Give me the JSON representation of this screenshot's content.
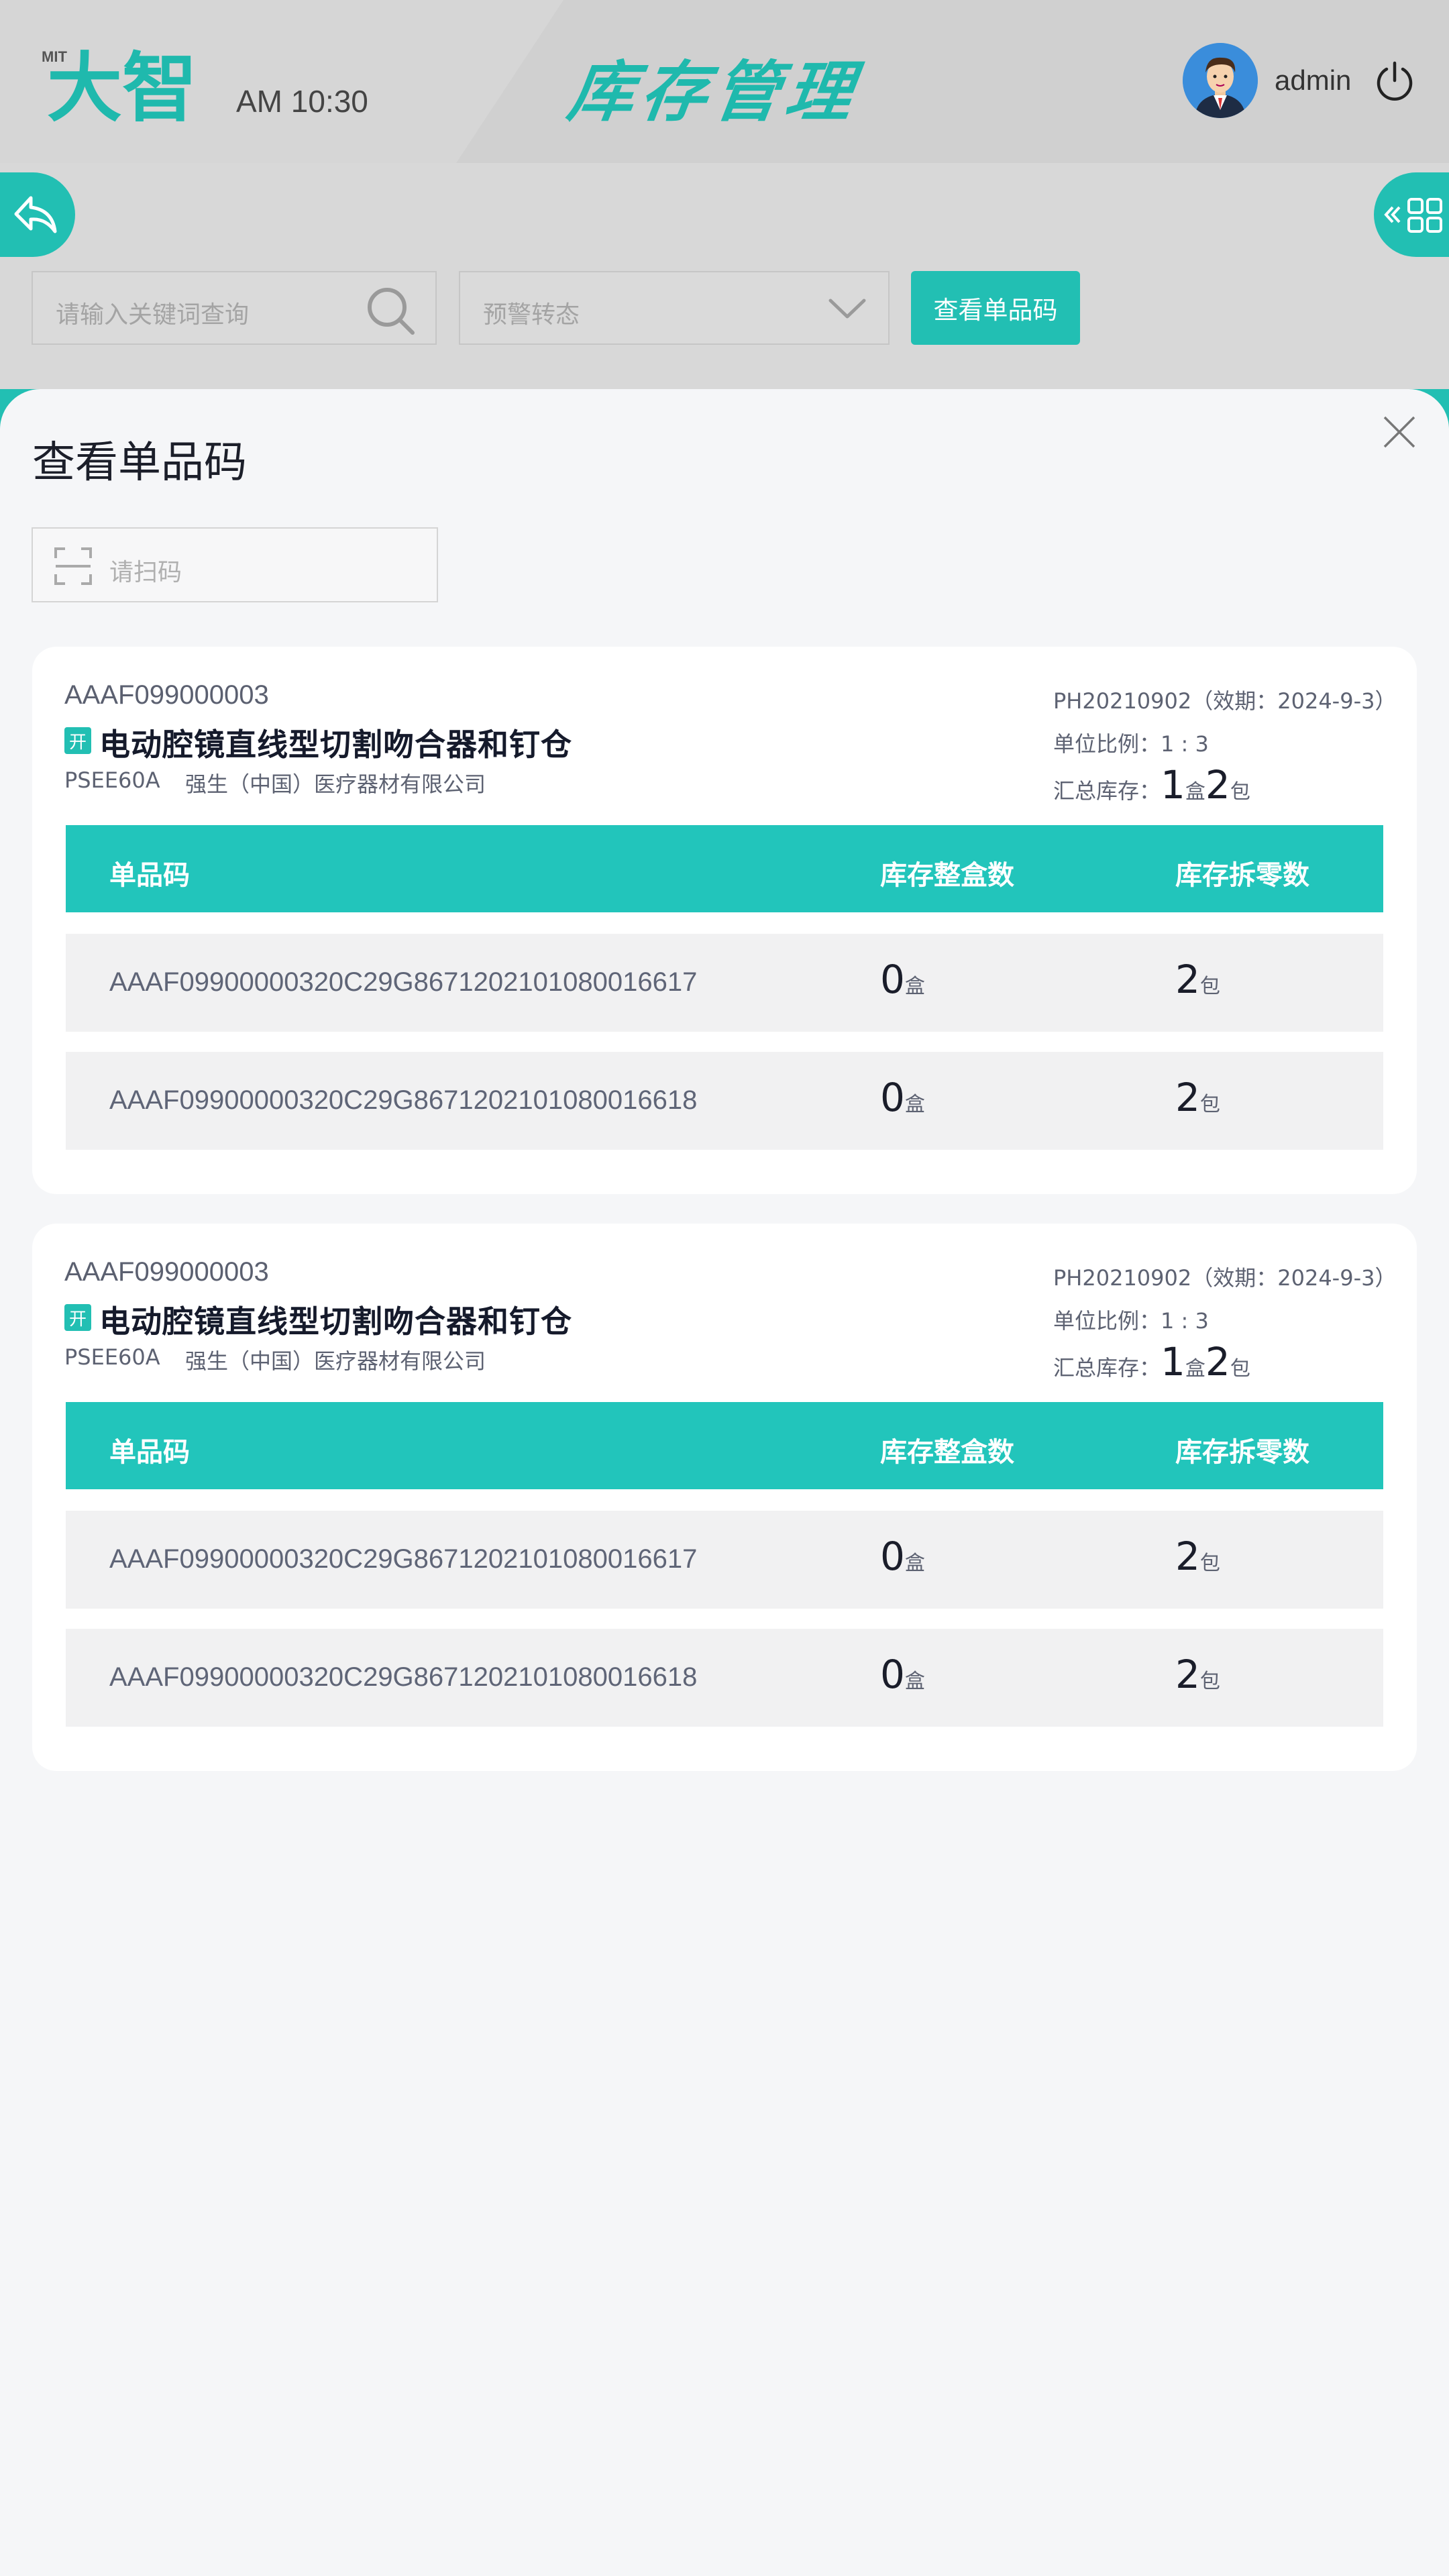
{
  "header": {
    "logo_text": "MIT大智",
    "time": "AM 10:30",
    "title": "库存管理",
    "user_name": "admin"
  },
  "toolbar": {
    "search_placeholder": "请输入关键词查询",
    "status_placeholder": "预警转态",
    "view_button": "查看单品码"
  },
  "modal": {
    "title": "查看单品码",
    "scan_placeholder": "请扫码",
    "cards": [
      {
        "code": "AAAF099000003",
        "tag": "开",
        "name": "电动腔镜直线型切割吻合器和钉仓",
        "spec": "PSEE60A",
        "manufacturer": "强生（中国）医疗器材有限公司",
        "batch": "PH20210902（效期：2024-9-3）",
        "ratio": "单位比例：1 : 3",
        "total_label": "汇总库存：",
        "total_boxes": "1",
        "total_box_unit": "盒",
        "total_packs": "2",
        "total_pack_unit": "包",
        "columns": [
          "单品码",
          "库存整盒数",
          "库存拆零数"
        ],
        "rows": [
          {
            "code": "AAAF09900000320C29G8671202101080016617",
            "boxes": "0",
            "box_unit": "盒",
            "packs": "2",
            "pack_unit": "包"
          },
          {
            "code": "AAAF09900000320C29G8671202101080016618",
            "boxes": "0",
            "box_unit": "盒",
            "packs": "2",
            "pack_unit": "包"
          }
        ]
      },
      {
        "code": "AAAF099000003",
        "tag": "开",
        "name": "电动腔镜直线型切割吻合器和钉仓",
        "spec": "PSEE60A",
        "manufacturer": "强生（中国）医疗器材有限公司",
        "batch": "PH20210902（效期：2024-9-3）",
        "ratio": "单位比例：1 : 3",
        "total_label": "汇总库存：",
        "total_boxes": "1",
        "total_box_unit": "盒",
        "total_packs": "2",
        "total_pack_unit": "包",
        "columns": [
          "单品码",
          "库存整盒数",
          "库存拆零数"
        ],
        "rows": [
          {
            "code": "AAAF09900000320C29G8671202101080016617",
            "boxes": "0",
            "box_unit": "盒",
            "packs": "2",
            "pack_unit": "包"
          },
          {
            "code": "AAAF09900000320C29G8671202101080016618",
            "boxes": "0",
            "box_unit": "盒",
            "packs": "2",
            "pack_unit": "包"
          }
        ]
      }
    ]
  },
  "colors": {
    "accent": "#22bfb3",
    "table_header": "#22c5bb",
    "header_bg": "#d6d6d6"
  },
  "icons": [
    "logo",
    "user-avatar",
    "power-icon",
    "back-arrow-icon",
    "grid-menu-icon",
    "search-icon",
    "chevron-down-icon",
    "close-icon",
    "scan-icon"
  ]
}
